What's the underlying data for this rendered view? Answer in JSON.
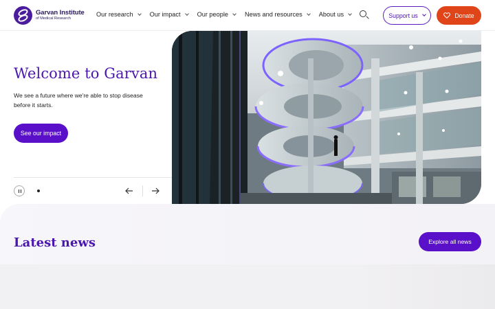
{
  "header": {
    "logo": {
      "line1": "Garvan Institute",
      "line2": "of Medical Research"
    },
    "nav": [
      {
        "label": "Our research"
      },
      {
        "label": "Our impact"
      },
      {
        "label": "Our people"
      },
      {
        "label": "News and resources"
      },
      {
        "label": "About us"
      }
    ],
    "search_icon": "search-icon",
    "support_label": "Support us",
    "donate_label": "Donate",
    "colors": {
      "brand_purple": "#4a16ad",
      "donate_orange": "#e0451a"
    }
  },
  "hero": {
    "title": "Welcome to Garvan",
    "description": "We see a future where we're able to stop disease before it starts.",
    "cta_label": "See our impact",
    "carousel": {
      "slides": 1,
      "active": 1,
      "paused": false
    }
  },
  "news": {
    "title": "Latest news",
    "explore_label": "Explore all news"
  }
}
